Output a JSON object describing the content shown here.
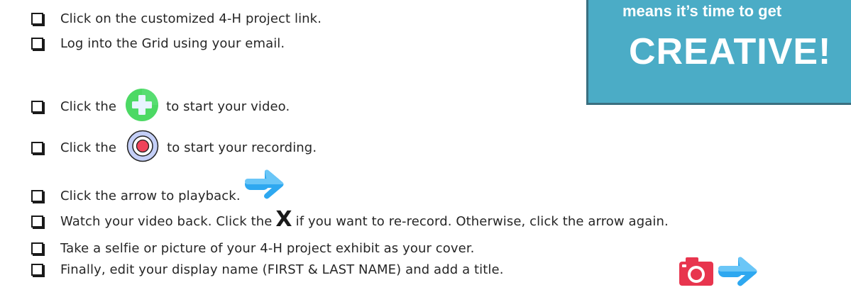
{
  "checklist": {
    "step1": "Click on the customized 4-H project link.",
    "step2": "Log into the Grid using your email.",
    "step3_before": "Click the",
    "step3_after": "to start your video.",
    "step4_before": "Click the",
    "step4_after": "to start your recording.",
    "step5": "Click the arrow to playback.",
    "step6_before": "Watch your video back. Click the",
    "step6_mark": "X",
    "step6_after": "if you want to re-record. Otherwise, click the arrow again.",
    "step7": "Take a selfie or picture of your 4-H project exhibit as your cover.",
    "step8": "Finally, edit your display name (FIRST & LAST NAME) and add a title."
  },
  "banner": {
    "line1": "means it’s time to get",
    "line2": "CREATIVE!"
  },
  "icons": {
    "add": "plus-circle-icon",
    "record": "record-button-icon",
    "arrow": "arrow-right-icon",
    "camera": "camera-icon"
  },
  "colors": {
    "banner_bg": "#4bacc6",
    "banner_border": "#3a6f80",
    "plus_green": "#4cd964",
    "record_red": "#f0435a",
    "record_ring": "#a9b8f2",
    "arrow_blue": "#2ea8f0",
    "camera_red": "#e8354e"
  }
}
